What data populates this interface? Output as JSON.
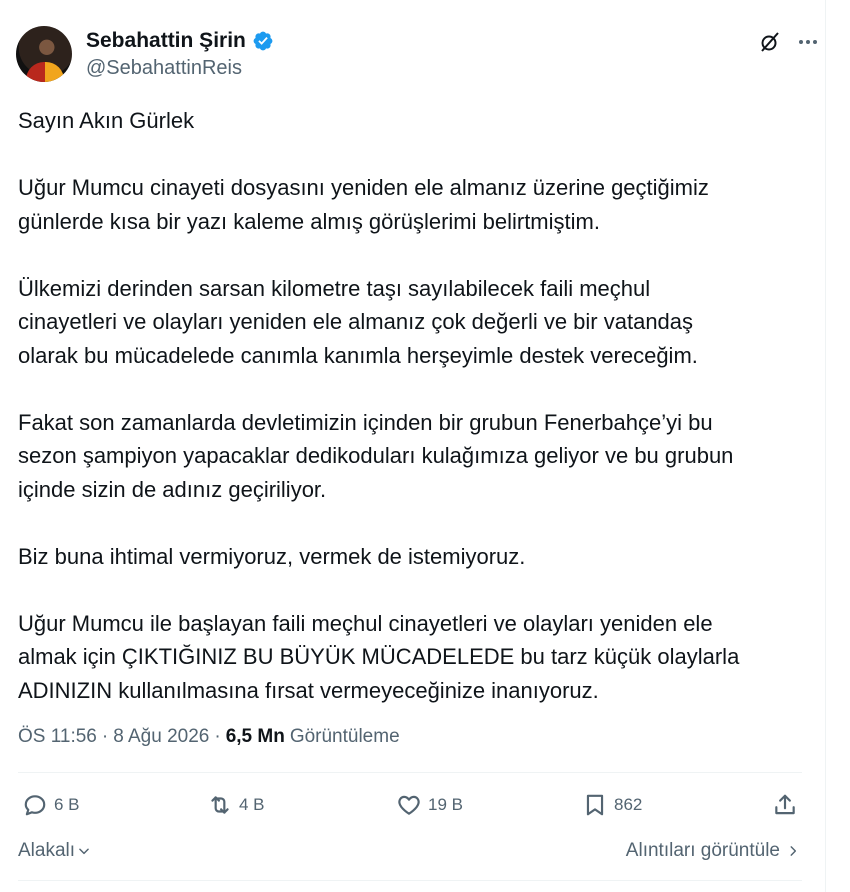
{
  "author": {
    "display_name": "Sebahattin Şirin",
    "handle": "@SebahattinReis",
    "verified": true,
    "verified_color": "#1d9bf0"
  },
  "tweet": {
    "paragraphs": [
      [
        "Sayın Akın Gürlek"
      ],
      [
        "Uğur Mumcu cinayeti dosyasını yeniden ele almanız üzerine geçtiğimiz",
        "günlerde kısa bir yazı kaleme almış görüşlerimi belirtmiştim."
      ],
      [
        "Ülkemizi derinden sarsan kilometre taşı sayılabilecek faili meçhul",
        "cinayetleri ve olayları yeniden ele almanız çok değerli ve bir vatandaş",
        "olarak bu mücadelede canımla kanımla herşeyimle destek vereceğim."
      ],
      [
        "Fakat son zamanlarda devletimizin içinden bir grubun Fenerbahçe’yi bu",
        "sezon şampiyon yapacaklar dedikoduları kulağımıza geliyor ve bu grubun",
        "içinde sizin de adınız geçiriliyor."
      ],
      [
        "Biz buna ihtimal vermiyoruz, vermek de istemiyoruz."
      ],
      [
        "Uğur Mumcu ile başlayan faili meçhul cinayetleri ve olayları yeniden ele",
        "almak için ÇIKTIĞINIZ BU BÜYÜK MÜCADELEDE bu tarz küçük olaylarla",
        "ADINIZIN kullanılmasına fırsat vermeyeceğinize inanıyoruz."
      ]
    ]
  },
  "meta": {
    "time": "ÖS 11:56",
    "separator": "·",
    "date": "8 Ağu 2026",
    "views_count": "6,5 Mn",
    "views_label": "Görüntüleme"
  },
  "actions": {
    "replies": "6 B",
    "reposts": "4 B",
    "likes": "19 B",
    "bookmarks": "862"
  },
  "footer": {
    "sort_label": "Alakalı",
    "quotes_label": "Alıntıları görüntüle"
  },
  "icons": {
    "verified": "verified-badge-icon",
    "grok": "grok-icon",
    "more": "more-icon",
    "reply": "reply-icon",
    "repost": "repost-icon",
    "like": "heart-icon",
    "bookmark": "bookmark-icon",
    "share": "share-icon"
  },
  "colors": {
    "text": "#0f1419",
    "secondary": "#536471",
    "divider": "#eff3f4"
  }
}
